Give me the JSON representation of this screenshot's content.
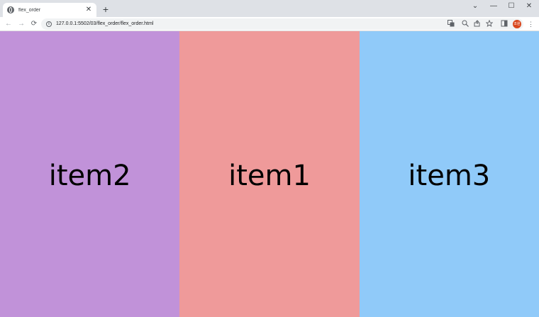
{
  "browser": {
    "tab": {
      "title": "flex_order",
      "close": "✕"
    },
    "new_tab": "+",
    "window_controls": {
      "chevron": "⌄",
      "minimize": "—",
      "maximize": "☐",
      "close": "✕"
    },
    "nav": {
      "back": "←",
      "forward": "→",
      "reload": "⟳"
    },
    "address": {
      "url": "127.0.0.1:5502/03/flex_order/flex_order.html",
      "info": "i"
    },
    "toolbar_icons": [
      "translate-icon",
      "zoom-icon",
      "share-icon",
      "star-icon",
      "sidepanel-icon"
    ],
    "avatar_text": "조원",
    "menu": "⋮"
  },
  "page": {
    "items": [
      {
        "label": "item2",
        "color": "#c192d9"
      },
      {
        "label": "item1",
        "color": "#ef9a9a"
      },
      {
        "label": "item3",
        "color": "#90caf9"
      }
    ]
  }
}
